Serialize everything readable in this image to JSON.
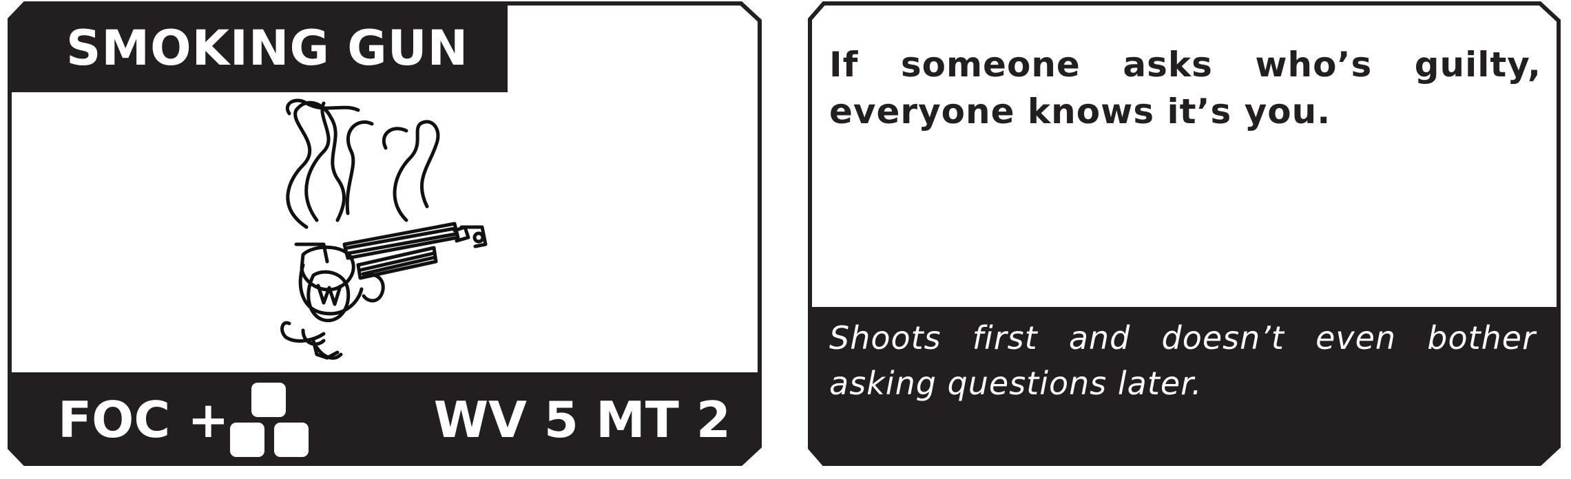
{
  "colors": {
    "ink": "#231f20",
    "paper": "#ffffff"
  },
  "card_front": {
    "title": "SMOKING GUN",
    "illustration_icon": "smoking-revolver-icon",
    "stat_left": "FOC +",
    "dice_icon": "three-dice-icon",
    "stat_right": "WV 5 MT 2"
  },
  "card_back": {
    "effect_text": "If someone asks who’s guilty, everyone knows it’s you.",
    "flavor_text": "Shoots first and doesn’t even bother asking questions later."
  }
}
